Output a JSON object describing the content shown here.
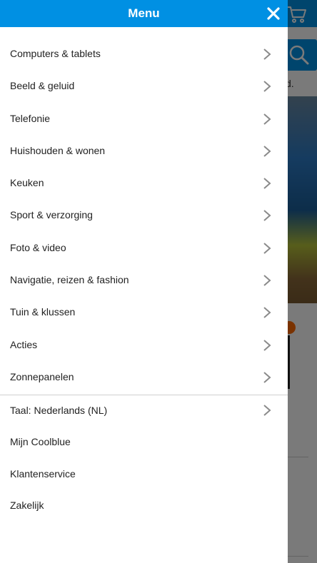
{
  "header": {
    "title": "Menu",
    "close_icon": "close-icon",
    "background_color": "#0090e3"
  },
  "menu": {
    "items": [
      {
        "label": "Computers & tablets"
      },
      {
        "label": "Beeld & geluid"
      },
      {
        "label": "Telefonie"
      },
      {
        "label": "Huishouden & wonen"
      },
      {
        "label": "Keuken"
      },
      {
        "label": "Sport & verzorging"
      },
      {
        "label": "Foto & video"
      },
      {
        "label": "Navigatie, reizen & fashion"
      },
      {
        "label": "Tuin & klussen"
      },
      {
        "label": "Acties"
      },
      {
        "label": "Zonnepanelen"
      }
    ]
  },
  "secondary": {
    "language": "Taal: Nederlands (NL)",
    "account": "Mijn Coolblue",
    "service": "Klantenservice",
    "business": "Zakelijk"
  },
  "background_page": {
    "partial_text": "d.",
    "cart_icon": "cart-icon",
    "search_icon": "search-icon"
  },
  "icons": {
    "chevron": "chevron-right-icon"
  }
}
